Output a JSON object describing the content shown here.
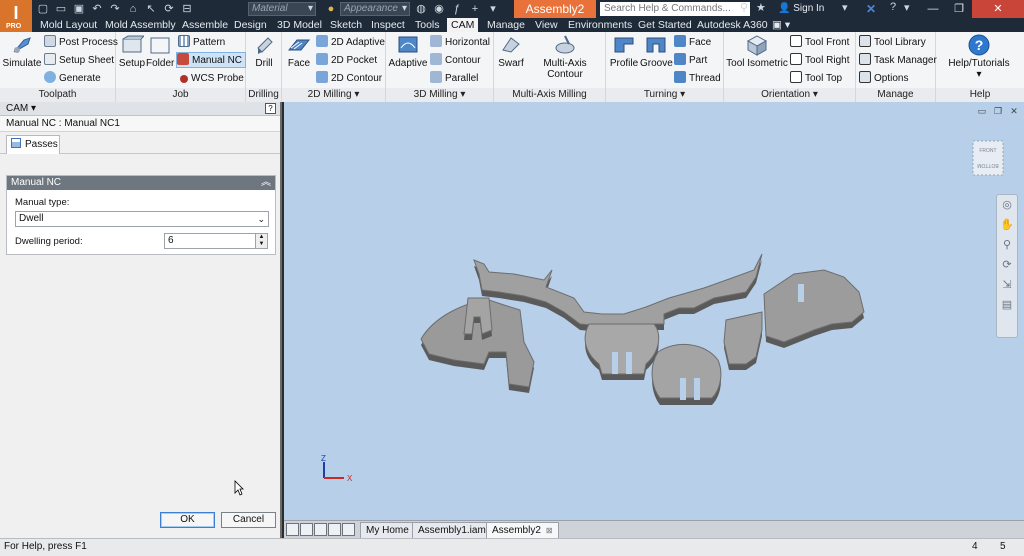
{
  "app": {
    "logo_letter": "I",
    "logo_badge": "PRO",
    "document_title": "Assembly2",
    "material_placeholder": "Material",
    "appearance_placeholder": "Appearance",
    "search_placeholder": "Search Help & Commands...",
    "signin_label": "Sign In",
    "accent_color": "#e8723a"
  },
  "tabs": [
    "Mold Layout",
    "Mold Assembly",
    "Assemble",
    "Design",
    "3D Model",
    "Sketch",
    "Inspect",
    "Tools",
    "CAM",
    "Manage",
    "View",
    "Environments",
    "Get Started",
    "Autodesk A360"
  ],
  "ribbon": {
    "toolpath": {
      "title": "Toolpath",
      "simulate": "Simulate",
      "post_process": "Post Process",
      "setup_sheet": "Setup Sheet",
      "generate": "Generate"
    },
    "job": {
      "title": "Job",
      "setup": "Setup",
      "folder": "Folder",
      "pattern": "Pattern",
      "manual_nc": "Manual NC",
      "wcs_probe": "WCS Probe"
    },
    "drilling": {
      "title": "Drilling",
      "drill": "Drill"
    },
    "milling2d": {
      "title": "2D Milling",
      "face": "Face",
      "adaptive": "2D Adaptive",
      "pocket": "2D Pocket",
      "contour": "2D Contour"
    },
    "milling3d": {
      "title": "3D Milling",
      "adaptive": "Adaptive",
      "horizontal": "Horizontal",
      "contour": "Contour",
      "parallel": "Parallel"
    },
    "multiaxis": {
      "title": "Multi-Axis Milling",
      "swarf": "Swarf",
      "contour": "Multi-Axis Contour"
    },
    "turning": {
      "title": "Turning",
      "profile": "Profile",
      "groove": "Groove",
      "face": "Face",
      "part": "Part",
      "thread": "Thread"
    },
    "orientation": {
      "title": "Orientation",
      "isometric": "Tool Isometric",
      "front": "Tool Front",
      "right": "Tool Right",
      "top": "Tool Top"
    },
    "manage": {
      "title": "Manage",
      "library": "Tool Library",
      "task_manager": "Task Manager",
      "options": "Options"
    },
    "help": {
      "title": "Help",
      "tutorials": "Help/Tutorials"
    }
  },
  "panel": {
    "header": "CAM",
    "operation": "Manual NC : Manual NC1",
    "tab": "Passes",
    "section": "Manual NC",
    "manual_type_label": "Manual type:",
    "manual_type_value": "Dwell",
    "dwell_label": "Dwelling period:",
    "dwell_value": "6",
    "ok": "OK",
    "cancel": "Cancel"
  },
  "viewport": {
    "viewcube_top": "FRONT",
    "viewcube_bottom": "BOTTOM",
    "axis_x": "X",
    "axis_z": "Z"
  },
  "doc_tabs": [
    "My Home",
    "Assembly1.iam",
    "Assembly2"
  ],
  "status": {
    "text": "For Help, press F1",
    "num1": "4",
    "num2": "5"
  }
}
